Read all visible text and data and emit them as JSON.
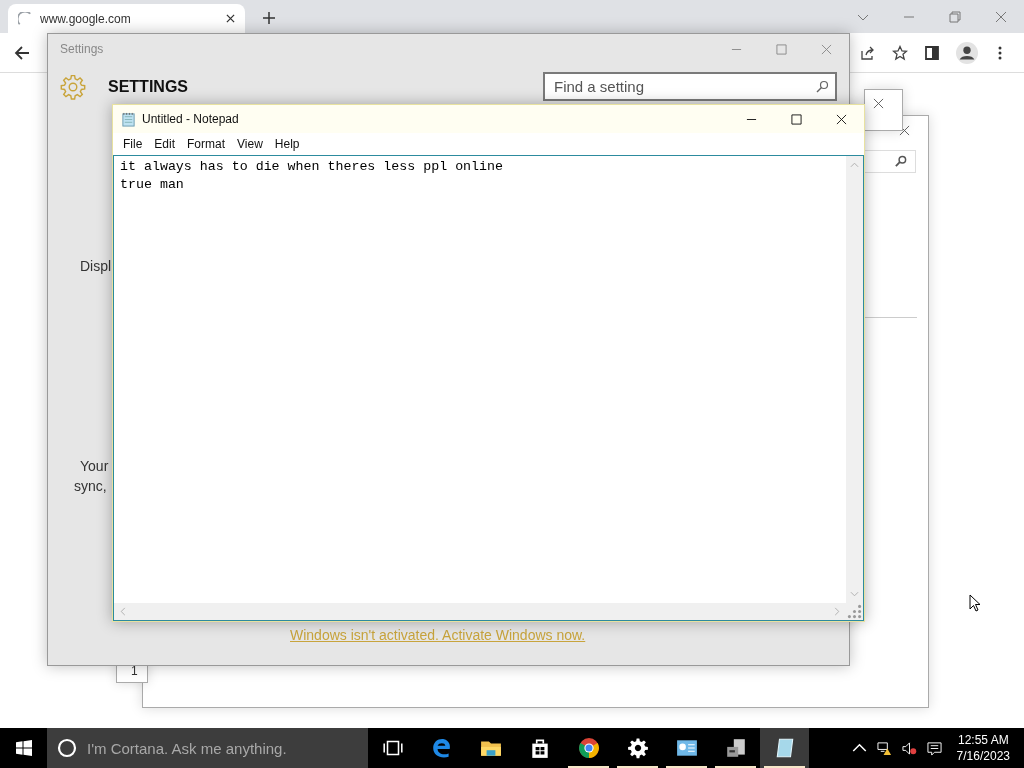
{
  "browser": {
    "tab": {
      "title": "www.google.com",
      "selected": true,
      "loading": true
    }
  },
  "background_windows": [
    {
      "kind": "search-panel"
    },
    {
      "kind": "plain"
    },
    {
      "kind": "label-stub",
      "text": "1"
    }
  ],
  "settings": {
    "window_title": "Settings",
    "heading": "SETTINGS",
    "search": {
      "placeholder": "Find a setting"
    },
    "partial_texts": [
      "Displ",
      "Your",
      "sync,"
    ],
    "activation_link": "Windows isn't activated. Activate Windows now."
  },
  "notepad": {
    "title": "Untitled - Notepad",
    "menu": [
      "File",
      "Edit",
      "Format",
      "View",
      "Help"
    ],
    "text": "it always has to die when theres less ppl online\ntrue man"
  },
  "taskbar": {
    "search": {
      "placeholder": "I'm Cortana. Ask me anything."
    },
    "apps": [
      {
        "kind": "task-view",
        "open": false,
        "selected": false
      },
      {
        "kind": "edge",
        "open": false,
        "selected": false
      },
      {
        "kind": "explorer",
        "open": false,
        "selected": false
      },
      {
        "kind": "store",
        "open": false,
        "selected": false
      },
      {
        "kind": "chrome",
        "open": true,
        "selected": false
      },
      {
        "kind": "settings",
        "open": true,
        "selected": false
      },
      {
        "kind": "control-panel",
        "open": true,
        "selected": false
      },
      {
        "kind": "drive",
        "open": true,
        "selected": false
      },
      {
        "kind": "notepad",
        "open": true,
        "selected": true
      }
    ],
    "time": "12:55 AM",
    "date": "7/16/2023"
  }
}
